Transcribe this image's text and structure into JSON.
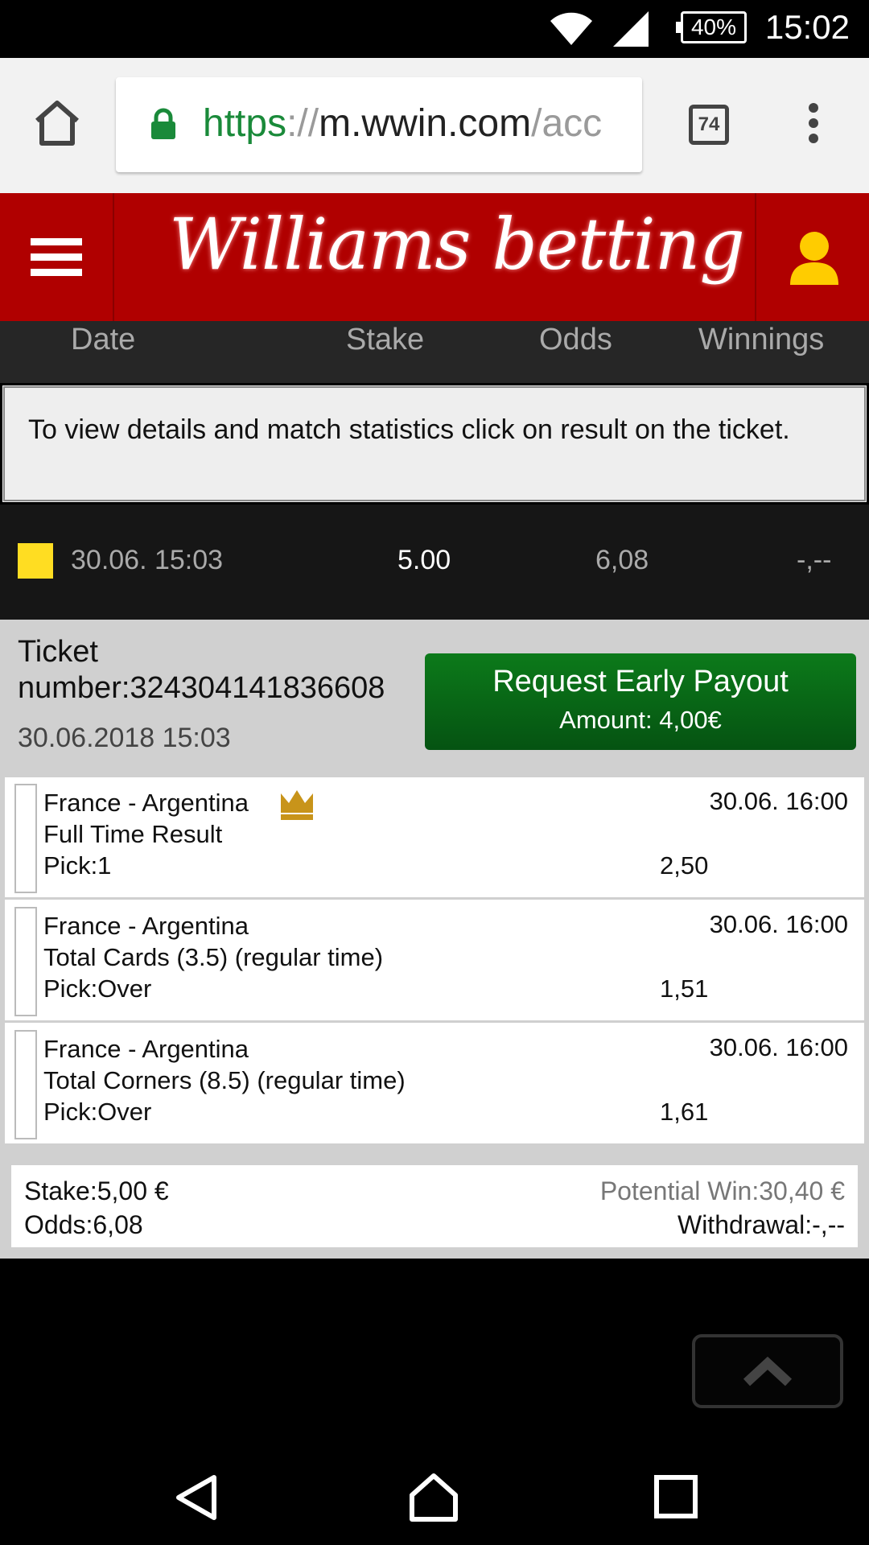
{
  "status_bar": {
    "time": "15:02",
    "battery": "40%",
    "wifi_icon": "wifi-icon",
    "signal_icon": "cell-signal-icon"
  },
  "browser": {
    "url_scheme": "https",
    "url_sep": "://",
    "url_host": "m.wwin.com",
    "url_path": "/acc",
    "tab_count": "74"
  },
  "site": {
    "logo_text": "Williams betting",
    "brand_color": "#b00000"
  },
  "columns": {
    "date": "Date",
    "stake": "Stake",
    "odds": "Odds",
    "winnings": "Winnings"
  },
  "info": {
    "text": "To view details and match statistics click on result on the ticket."
  },
  "ticket_row": {
    "date": "30.06. 15:03",
    "stake": "5.00",
    "odds": "6,08",
    "winnings": "-,--"
  },
  "ticket": {
    "number_label": "Ticket number:324304141836608",
    "datetime": "30.06.2018 15:03",
    "payout_button": {
      "label": "Request Early Payout",
      "amount": "Amount: 4,00€"
    },
    "matches": [
      {
        "teams": "France - Argentina",
        "market": "Full Time Result",
        "pick": "Pick:1",
        "date": "30.06. 16:00",
        "odd": "2,50"
      },
      {
        "teams": "France - Argentina",
        "market": "Total Cards (3.5) (regular time)",
        "pick": "Pick:Over",
        "date": "30.06. 16:00",
        "odd": "1,51"
      },
      {
        "teams": "France - Argentina",
        "market": "Total Corners (8.5) (regular time)",
        "pick": "Pick:Over",
        "date": "30.06. 16:00",
        "odd": "1,61"
      }
    ],
    "totals": {
      "stake": "Stake:5,00 €",
      "odds": "Odds:6,08",
      "potential_win": "Potential Win:30,40 €",
      "withdrawal": "Withdrawal:-,--"
    }
  }
}
